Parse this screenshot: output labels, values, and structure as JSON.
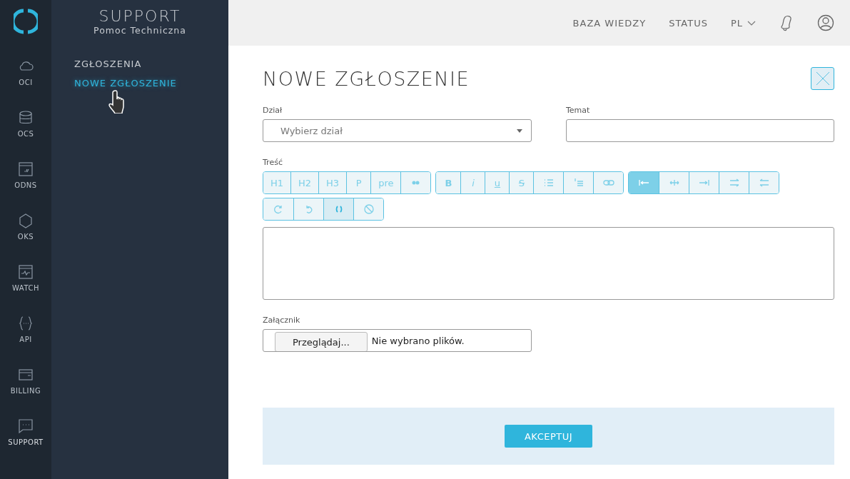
{
  "rail": {
    "items": [
      {
        "label": "OCI",
        "selected": false
      },
      {
        "label": "OCS",
        "selected": false
      },
      {
        "label": "ODNS",
        "selected": false
      },
      {
        "label": "OKS",
        "selected": false
      },
      {
        "label": "WATCH",
        "selected": false
      },
      {
        "label": "API",
        "selected": false
      },
      {
        "label": "BILLING",
        "selected": false
      },
      {
        "label": "SUPPORT",
        "selected": true
      }
    ]
  },
  "sidebar": {
    "title": "SUPPORT",
    "subtitle": "Pomoc Techniczna",
    "items": [
      {
        "label": "ZGŁOSZENIA",
        "selected": false
      },
      {
        "label": "NOWE ZGŁOSZENIE",
        "selected": true
      }
    ]
  },
  "topbar": {
    "links": [
      "BAZA WIEDZY",
      "STATUS"
    ],
    "language": "PL"
  },
  "form": {
    "title": "NOWE ZGŁOSZENIE",
    "department": {
      "label": "Dział",
      "placeholder": "Wybierz dział"
    },
    "subject": {
      "label": "Temat"
    },
    "content": {
      "label": "Treść"
    },
    "toolbar": [
      [
        {
          "kind": "text",
          "label": "H1",
          "selected": false
        },
        {
          "kind": "text",
          "label": "H2",
          "selected": false
        },
        {
          "kind": "text",
          "label": "H3",
          "selected": false
        },
        {
          "kind": "text",
          "label": "P",
          "selected": false
        },
        {
          "kind": "text",
          "label": "pre",
          "selected": false
        },
        {
          "kind": "icon",
          "selected": false
        }
      ],
      [
        {
          "kind": "text",
          "label": "B",
          "selected": false
        },
        {
          "kind": "text",
          "label": "i",
          "selected": false
        },
        {
          "kind": "text",
          "label": "u",
          "selected": false
        },
        {
          "kind": "text",
          "label": "S",
          "selected": false
        },
        {
          "kind": "icon",
          "selected": false
        },
        {
          "kind": "icon",
          "selected": false
        },
        {
          "kind": "icon",
          "selected": false
        }
      ],
      [
        {
          "kind": "icon",
          "selected": true
        },
        {
          "kind": "icon",
          "selected": false
        },
        {
          "kind": "icon",
          "selected": false
        },
        {
          "kind": "icon",
          "selected": false
        },
        {
          "kind": "icon",
          "selected": false
        }
      ],
      [
        {
          "kind": "icon",
          "selected": false
        },
        {
          "kind": "icon",
          "selected": false
        },
        {
          "kind": "icon",
          "selected": true
        },
        {
          "kind": "icon",
          "selected": false
        }
      ]
    ],
    "attachment": {
      "label": "Załącznik",
      "button": "Przeglądaj...",
      "status": "Nie wybrano plików."
    },
    "submit": "AKCEPTUJ"
  }
}
